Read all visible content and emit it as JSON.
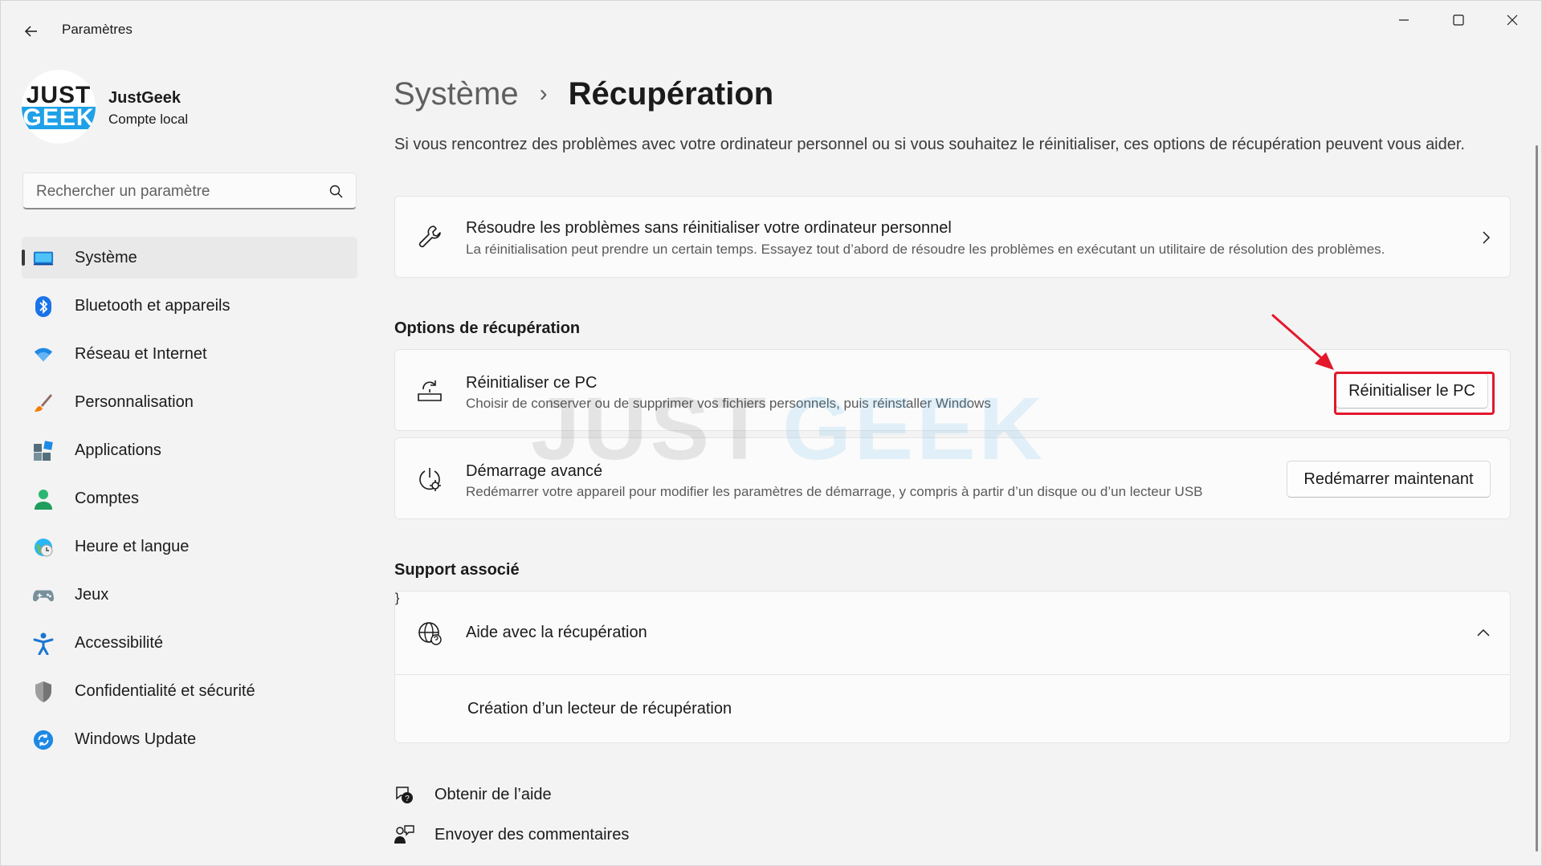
{
  "window": {
    "app_title": "Paramètres",
    "controls": {
      "minimize": "minimize-icon",
      "maximize": "maximize-icon",
      "close": "close-icon"
    }
  },
  "profile": {
    "name": "JustGeek",
    "account_type": "Compte local",
    "logo_top": "JUST",
    "logo_bottom": "GEEK"
  },
  "search": {
    "placeholder": "Rechercher un paramètre",
    "value": ""
  },
  "sidebar": {
    "items": [
      {
        "label": "Système",
        "icon": "system-icon",
        "active": true
      },
      {
        "label": "Bluetooth et appareils",
        "icon": "bluetooth-icon"
      },
      {
        "label": "Réseau et Internet",
        "icon": "wifi-icon"
      },
      {
        "label": "Personnalisation",
        "icon": "brush-icon"
      },
      {
        "label": "Applications",
        "icon": "apps-icon"
      },
      {
        "label": "Comptes",
        "icon": "accounts-icon"
      },
      {
        "label": "Heure et langue",
        "icon": "time-language-icon"
      },
      {
        "label": "Jeux",
        "icon": "gamepad-icon"
      },
      {
        "label": "Accessibilité",
        "icon": "accessibility-icon"
      },
      {
        "label": "Confidentialité et sécurité",
        "icon": "shield-icon"
      },
      {
        "label": "Windows Update",
        "icon": "update-icon"
      }
    ]
  },
  "main": {
    "breadcrumb": {
      "parent": "Système",
      "separator": "›",
      "current": "Récupération"
    },
    "intro": "Si vous rencontrez des problèmes avec votre ordinateur personnel ou si vous souhaitez le réinitialiser, ces options de récupération peuvent vous aider.",
    "troubleshoot": {
      "title": "Résoudre les problèmes sans réinitialiser votre ordinateur personnel",
      "description": "La réinitialisation peut prendre un certain temps. Essayez tout d’abord de résoudre les problèmes en exécutant un utilitaire de résolution des problèmes."
    },
    "recovery_options": {
      "heading": "Options de récupération",
      "reset": {
        "title": "Réinitialiser ce PC",
        "description": "Choisir de conserver ou de supprimer vos fichiers personnels, puis réinstaller Windows",
        "button": "Réinitialiser le PC"
      },
      "advanced": {
        "title": "Démarrage avancé",
        "description": "Redémarrer votre appareil pour modifier les paramètres de démarrage, y compris à partir d’un disque ou d’un lecteur USB",
        "button": "Redémarrer maintenant"
      }
    },
    "support": {
      "heading": "Support associé",
      "help_title": "Aide avec la récupération",
      "link": "Création d’un lecteur de récupération"
    },
    "footer": {
      "get_help": "Obtenir de l’aide",
      "feedback": "Envoyer des commentaires"
    },
    "watermark": {
      "part1": "JUST",
      "part2": "GEEK"
    }
  },
  "colors": {
    "accent": "#0067c0",
    "annotation": "#e3182b",
    "brand_blue": "#1ea1e8"
  }
}
